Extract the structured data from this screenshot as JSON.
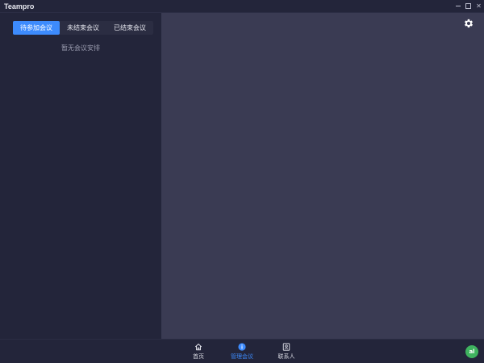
{
  "window": {
    "title": "Teampro",
    "controls": [
      "minimize-icon",
      "maximize-icon",
      "close-icon"
    ]
  },
  "sidebar": {
    "tabs": [
      {
        "label": "待参加会议",
        "active": true
      },
      {
        "label": "未结束会议",
        "active": false
      },
      {
        "label": "已结束会议",
        "active": false
      }
    ],
    "empty_message": "暂无会议安排"
  },
  "main": {
    "settings_icon": "gear-icon"
  },
  "bottom_nav": {
    "items": [
      {
        "label": "首页",
        "icon": "home-icon",
        "active": false
      },
      {
        "label": "管理会议",
        "icon": "info-icon",
        "active": true
      },
      {
        "label": "联系人",
        "icon": "contacts-icon",
        "active": false
      }
    ],
    "avatar_text": "al"
  },
  "colors": {
    "accent": "#3d8bfd",
    "sidebar_bg": "#23253a",
    "main_bg": "#3a3b53",
    "avatar_bg": "#3fb35f"
  }
}
